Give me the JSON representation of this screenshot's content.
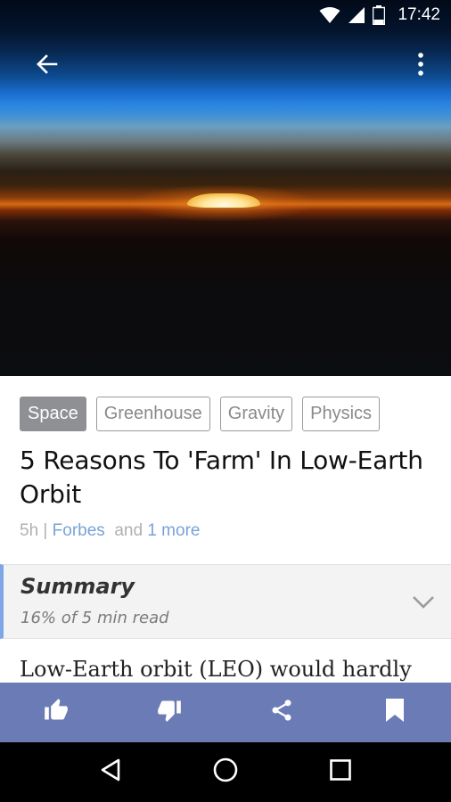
{
  "status_bar": {
    "time": "17:42",
    "icons": [
      "wifi-icon",
      "signal-icon",
      "battery-icon"
    ]
  },
  "hero": {
    "toolbar": {
      "back_icon": "arrow-left-icon",
      "menu_icon": "more-vertical-icon"
    }
  },
  "tags": [
    {
      "label": "Space",
      "active": true
    },
    {
      "label": "Greenhouse",
      "active": false
    },
    {
      "label": "Gravity",
      "active": false
    },
    {
      "label": "Physics",
      "active": false
    }
  ],
  "article": {
    "title": "5 Reasons To 'Farm' In Low-Earth Orbit",
    "age": "5h",
    "separator": " | ",
    "source": "Forbes",
    "and_text": "  and ",
    "more": "1 more",
    "body_preview": "Low-Earth orbit (LEO) would hardly"
  },
  "summary": {
    "title": "Summary",
    "progress_text": "16% of 5 min read",
    "chevron_icon": "chevron-down-icon"
  },
  "action_bar": {
    "items": [
      "thumbs-up-icon",
      "thumbs-down-icon",
      "share-icon",
      "bookmark-icon"
    ]
  },
  "nav_bar": {
    "items": [
      "back-triangle-icon",
      "home-circle-icon",
      "recents-square-icon"
    ]
  },
  "colors": {
    "accent": "#6b7bb6",
    "summary_border": "#7ea6e6",
    "link": "#7aa3d6",
    "active_tag": "#8e9093"
  }
}
